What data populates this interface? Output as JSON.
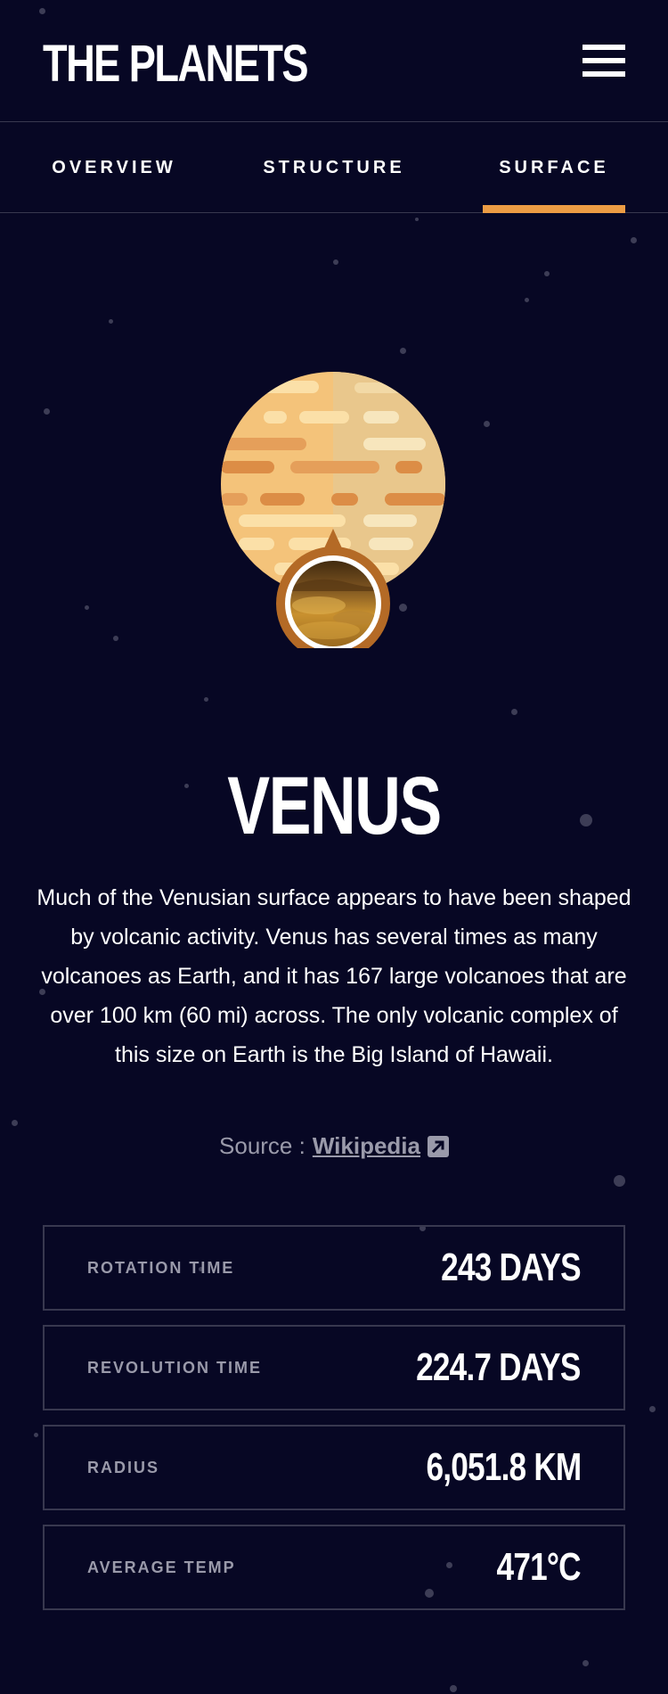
{
  "app": {
    "title": "THE PLANETS"
  },
  "nav": {
    "tabs": [
      {
        "label": "OVERVIEW",
        "active": false
      },
      {
        "label": "STRUCTURE",
        "active": false
      },
      {
        "label": "SURFACE",
        "active": true
      }
    ],
    "active_color": "#ec9c44"
  },
  "planet": {
    "name": "VENUS",
    "description": "Much of the Venusian surface appears to have been shaped by volcanic activity. Venus has several times as many volcanoes as Earth, and it has 167 large volcanoes that are over 100 km (60 mi) across. The only volcanic complex of this size on Earth is the Big Island of Hawaii.",
    "source_prefix": "Source :",
    "source_link": "Wikipedia",
    "image": "venus-planet-with-surface-geology-inset"
  },
  "stats": [
    {
      "label": "ROTATION TIME",
      "value": "243 DAYS"
    },
    {
      "label": "REVOLUTION TIME",
      "value": "224.7 DAYS"
    },
    {
      "label": "RADIUS",
      "value": "6,051.8 KM"
    },
    {
      "label": "AVERAGE TEMP",
      "value": "471°C"
    }
  ],
  "icons": {
    "menu": "hamburger-menu-icon",
    "source": "external-link-icon"
  },
  "colors": {
    "background": "#070724",
    "border": "#38384f",
    "muted_text": "#9a9aaa",
    "accent": "#ec9c44"
  }
}
